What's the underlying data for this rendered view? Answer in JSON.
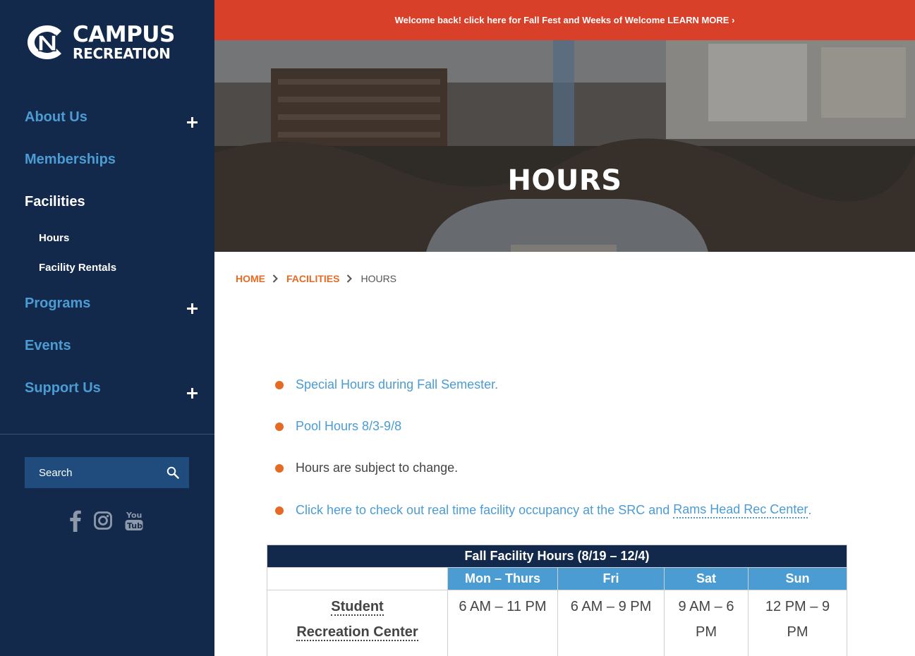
{
  "logo": {
    "line1": "CAMPUS",
    "line2": "RECREATION",
    "mark_icon": "nc-logo-icon"
  },
  "nav": {
    "items": [
      {
        "label": "About Us",
        "expandable": true
      },
      {
        "label": "Memberships",
        "expandable": false
      },
      {
        "label": "Facilities",
        "expandable": false,
        "active": true
      },
      {
        "label": "Programs",
        "expandable": true
      },
      {
        "label": "Events",
        "expandable": false
      },
      {
        "label": "Support Us",
        "expandable": true
      }
    ],
    "subitems": [
      "Hours",
      "Facility Rentals"
    ]
  },
  "search": {
    "placeholder": "Search"
  },
  "social": [
    "facebook-icon",
    "instagram-icon",
    "youtube-icon"
  ],
  "alert": {
    "text": "Welcome back! click here for Fall Fest and Weeks of Welcome LEARN MORE ›"
  },
  "hero": {
    "title": "HOURS"
  },
  "breadcrumb": {
    "home": "HOME",
    "facilities": "FACILITIES",
    "current": "HOURS"
  },
  "bullets": {
    "b1": "Special Hours during Fall Semester.",
    "b2": "Pool Hours 8/3-9/8",
    "b3": "Hours are subject to change.",
    "b4_link": "Click here to check out real time facility occupancy at the SRC and ",
    "b4_link2": "Rams Head Rec Center",
    "b4_end": "."
  },
  "table": {
    "title": "Fall Facility Hours (8/19 – 12/4)",
    "headers": [
      "Mon – Thurs",
      "Fri",
      "Sat",
      "Sun"
    ],
    "row": {
      "facility": "Student Recreation Center",
      "cells": [
        "6 AM – 11 PM",
        "6 AM – 9 PM",
        "9 AM – 6 PM",
        "12 PM – 9 PM"
      ]
    }
  },
  "colors": {
    "navy": "#13294b",
    "carolina_blue": "#4b9cd3",
    "orange": "#e56a24",
    "alert_red": "#d9402a"
  }
}
